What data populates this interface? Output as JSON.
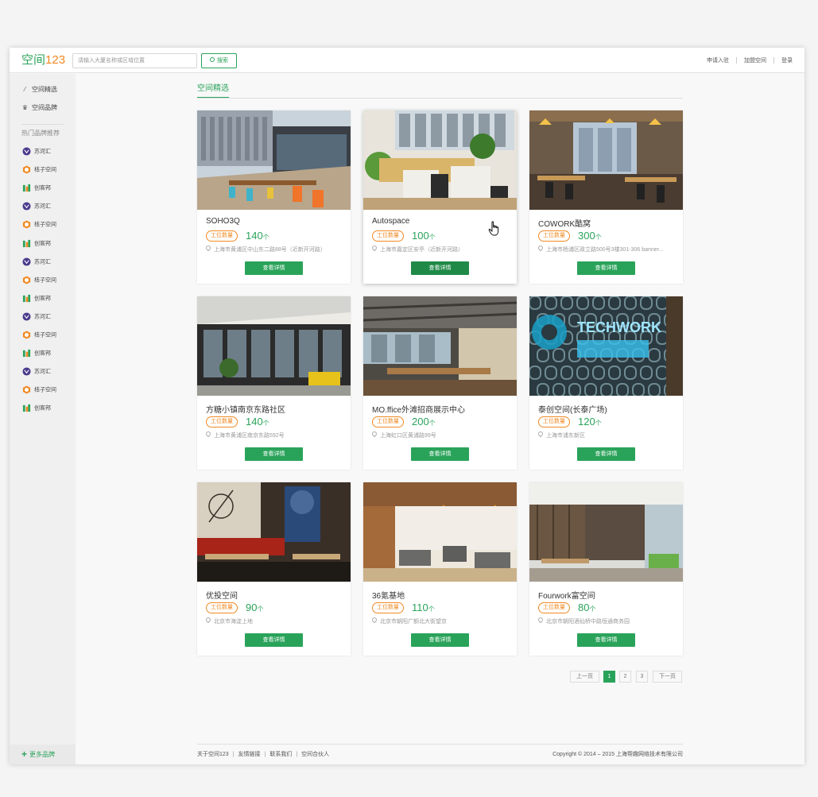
{
  "header": {
    "logo_text": "空间",
    "logo_num": "123",
    "search_placeholder": "请输入大厦名称或区域位置",
    "search_button": "搜索",
    "links": [
      "申请入驻",
      "加盟空间",
      "登录"
    ]
  },
  "sidebar": {
    "nav": [
      {
        "label": "空间精选",
        "icon": "magic-wand-icon"
      },
      {
        "label": "空间品牌",
        "icon": "crown-icon"
      }
    ],
    "brands_heading": "热门品牌推荐",
    "brands": [
      "苏河汇",
      "桔子空间",
      "创客邦",
      "苏河汇",
      "桔子空间",
      "创客邦",
      "苏河汇",
      "桔子空间",
      "创客邦",
      "苏河汇",
      "桔子空间",
      "创客邦",
      "苏河汇",
      "桔子空间",
      "创客邦"
    ],
    "more_brands": "更多品牌"
  },
  "main": {
    "section_title": "空间精选",
    "tag_label": "工位数量",
    "unit": "个",
    "detail_button": "查看详情",
    "cards": [
      {
        "name": "SOHO3Q",
        "count": "140",
        "address": "上海市黄浦区中山东二路88号（近新开河路）"
      },
      {
        "name": "Autospace",
        "count": "100",
        "address": "上海市嘉定区安亭（近新开河路）"
      },
      {
        "name": "COWORK酷窝",
        "count": "300",
        "address": "上海市杨浦区政立路500号3楼301-306 banner..."
      },
      {
        "name": "方糖小镇南京东路社区",
        "count": "140",
        "address": "上海市黄浦区南京东路592号"
      },
      {
        "name": "MO.ffice外滩招商展示中心",
        "count": "200",
        "address": "上海虹口区黄浦路99号"
      },
      {
        "name": "泰创空间(长泰广场)",
        "count": "120",
        "address": "上海市浦东新区"
      },
      {
        "name": "优投空间",
        "count": "90",
        "address": "北京市海淀上地"
      },
      {
        "name": "36氪基地",
        "count": "110",
        "address": "北京市朝阳广额北大街望京"
      },
      {
        "name": "Fourwork富空间",
        "count": "80",
        "address": "北京市朝阳酒仙桥中路恒通商务园"
      }
    ]
  },
  "pagination": {
    "prev": "上一页",
    "pages": [
      "1",
      "2",
      "3"
    ],
    "current": "1",
    "next": "下一页"
  },
  "footer": {
    "links": [
      "关于空间123",
      "友情链接",
      "联系我们",
      "空间合伙人"
    ],
    "copyright": "Copyright © 2014 – 2015 上海帮趣网络技术有限公司"
  },
  "colors": {
    "accent": "#2aa35a",
    "orange": "#f08a24"
  }
}
